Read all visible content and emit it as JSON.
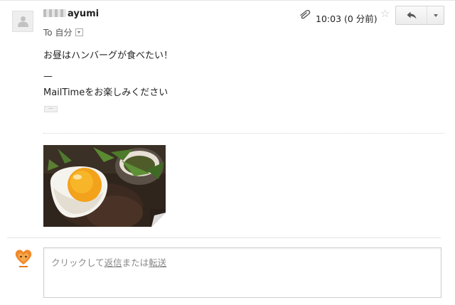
{
  "message": {
    "sender": {
      "name": "ayumi",
      "icon": "person-silhouette-icon"
    },
    "recipient": {
      "label": "To 自分"
    },
    "timestamp": "10:03 (0 分前)",
    "icons": {
      "attachment": "paperclip-icon",
      "star": "star-icon",
      "reply": "reply-arrow-icon",
      "more": "dropdown-arrow-icon"
    },
    "star_glyph": "☆",
    "body": {
      "line1": "お昼はハンバーグが食べたい！",
      "line2": "—",
      "line3": "MailTimeをお楽しみください",
      "trimmed_content_label": "···"
    },
    "attachment_image": "fried-egg-hamburger-photo"
  },
  "reply": {
    "hint_prefix": "クリックして",
    "reply_link": "返信",
    "hint_middle": "または",
    "forward_link": "転送",
    "avatar_icon": "heart-logo-icon"
  },
  "colors": {
    "border": "#cfcfcf",
    "egg_yolk": "#f3a21c",
    "text": "#222222",
    "muted": "#888888"
  }
}
